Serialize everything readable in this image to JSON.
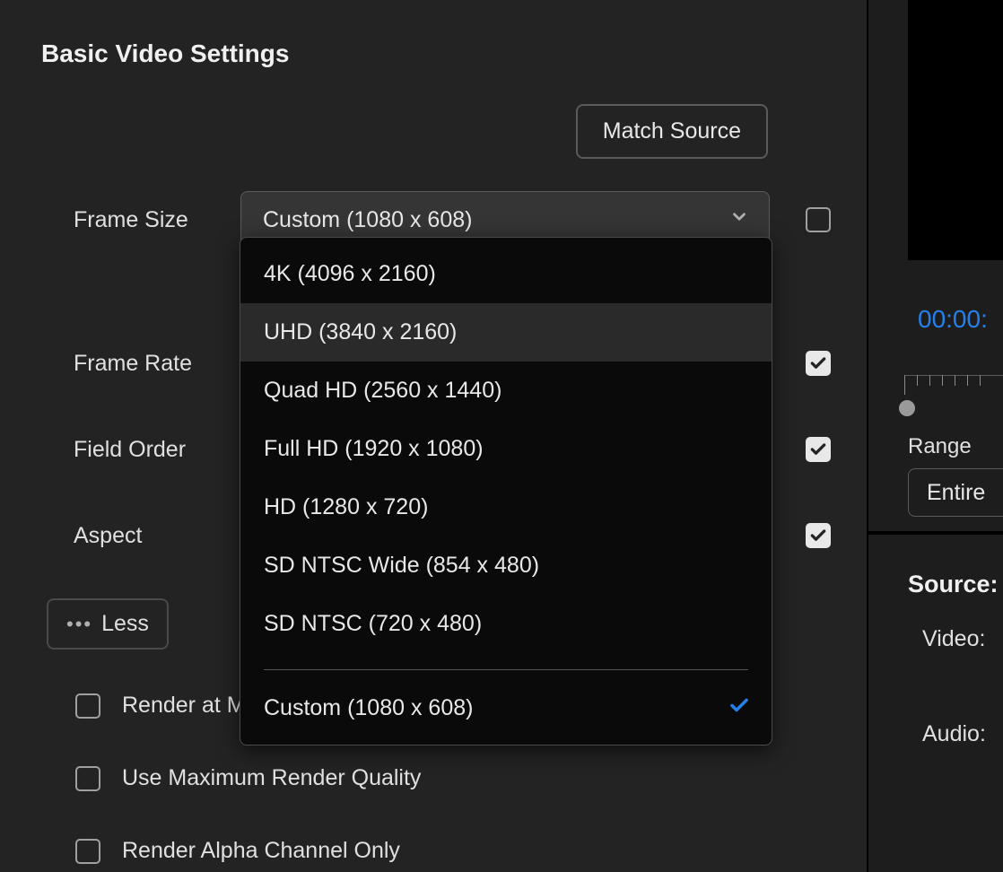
{
  "section_title": "Basic Video Settings",
  "match_source_label": "Match Source",
  "fields": {
    "frame_size": {
      "label": "Frame Size",
      "value": "Custom (1080 x 608)",
      "locked": false
    },
    "frame_rate": {
      "label": "Frame Rate",
      "locked": true
    },
    "field_order": {
      "label": "Field Order",
      "locked": true
    },
    "aspect": {
      "label": "Aspect",
      "locked": true
    }
  },
  "frame_size_options": [
    "4K (4096 x 2160)",
    "UHD (3840 x 2160)",
    "Quad HD (2560 x 1440)",
    "Full HD (1920 x 1080)",
    "HD (1280 x 720)",
    "SD NTSC Wide (854 x 480)",
    "SD NTSC (720 x 480)"
  ],
  "frame_size_custom": "Custom (1080 x 608)",
  "hovered_option_index": 1,
  "less_label": "Less",
  "options": {
    "render_max_depth": "Render at Max",
    "use_max_render_quality": "Use Maximum Render Quality",
    "render_alpha_only": "Render Alpha Channel Only"
  },
  "right": {
    "timecode": "00:00:",
    "range_label": "Range",
    "range_value": "Entire",
    "source_title": "Source:",
    "video_label": "Video:",
    "audio_label": "Audio:"
  }
}
